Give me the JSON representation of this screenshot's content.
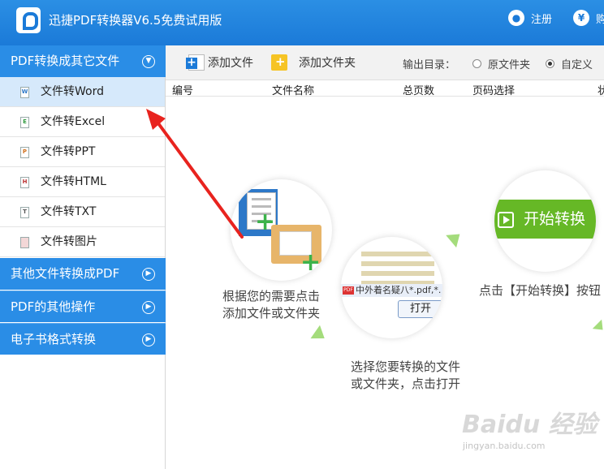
{
  "titlebar": {
    "title": "迅捷PDF转换器V6.5免费试用版",
    "register_label": "注册",
    "buy_label": "购"
  },
  "sidebar": {
    "categories": [
      {
        "label": "PDF转换成其它文件",
        "expanded": true
      },
      {
        "label": "其他文件转换成PDF",
        "expanded": false
      },
      {
        "label": "PDF的其他操作",
        "expanded": false
      },
      {
        "label": "电子书格式转换",
        "expanded": false
      }
    ],
    "sub_items": [
      {
        "label": "文件转Word",
        "icon": "W",
        "active": true
      },
      {
        "label": "文件转Excel",
        "icon": "E",
        "active": false
      },
      {
        "label": "文件转PPT",
        "icon": "P",
        "active": false
      },
      {
        "label": "文件转HTML",
        "icon": "H",
        "active": false
      },
      {
        "label": "文件转TXT",
        "icon": "T",
        "active": false
      },
      {
        "label": "文件转图片",
        "icon": "",
        "active": false
      }
    ]
  },
  "toolbar": {
    "add_file": "添加文件",
    "add_folder": "添加文件夹",
    "output_label": "输出目录：",
    "radio_original": "原文件夹",
    "radio_custom": "自定义",
    "selected": "custom"
  },
  "table": {
    "columns": [
      "编号",
      "文件名称",
      "总页数",
      "页码选择",
      "状"
    ]
  },
  "steps": {
    "step1": [
      "根据您的需要点击",
      "添加文件或文件夹"
    ],
    "step2": [
      "选择您要转换的文件",
      "或文件夹，点击打开"
    ],
    "step3": "点击【开始转换】按钮",
    "dialog_text": "中外着名疑八*.pdf,*.",
    "open_button": "打开",
    "start_button": "开始转换"
  },
  "watermark": {
    "main": "Baidu 经验",
    "sub": "jingyan.baidu.com"
  },
  "colors": {
    "accent": "#2a8de6",
    "active_bg": "#d6e9fb",
    "green": "#66b826"
  }
}
